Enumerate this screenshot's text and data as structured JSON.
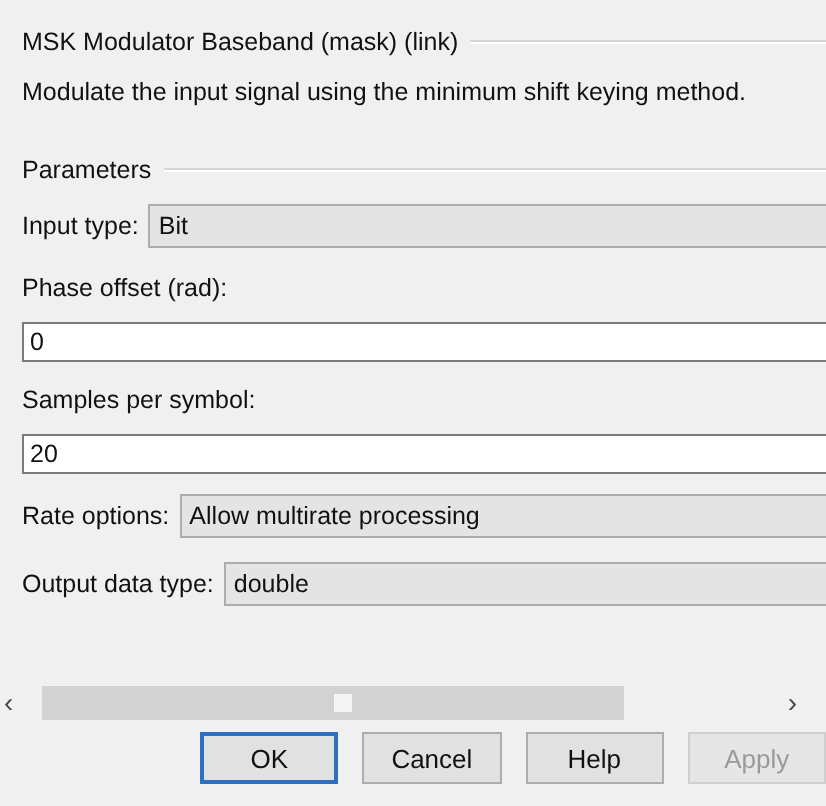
{
  "block_title": "MSK Modulator Baseband (mask) (link)",
  "description": "Modulate the input signal using the minimum shift keying method.",
  "group_title": "Parameters",
  "parameters": [
    {
      "kind": "dropdown",
      "label": "Input type:",
      "value": "Bit"
    },
    {
      "kind": "edit",
      "label": "Phase offset (rad):",
      "value": "0"
    },
    {
      "kind": "edit",
      "label": "Samples per symbol:",
      "value": "20"
    },
    {
      "kind": "dropdown",
      "label": "Rate options:",
      "value": "Allow multirate processing"
    },
    {
      "kind": "dropdown",
      "label": "Output data type:",
      "value": "double"
    }
  ],
  "scrollbar": {
    "left_arrow": "‹",
    "right_arrow": "›"
  },
  "buttons": [
    {
      "label": "OK",
      "focused": true,
      "disabled": false
    },
    {
      "label": "Cancel",
      "focused": false,
      "disabled": false
    },
    {
      "label": "Help",
      "focused": false,
      "disabled": false
    },
    {
      "label": "Apply",
      "focused": false,
      "disabled": true
    }
  ]
}
